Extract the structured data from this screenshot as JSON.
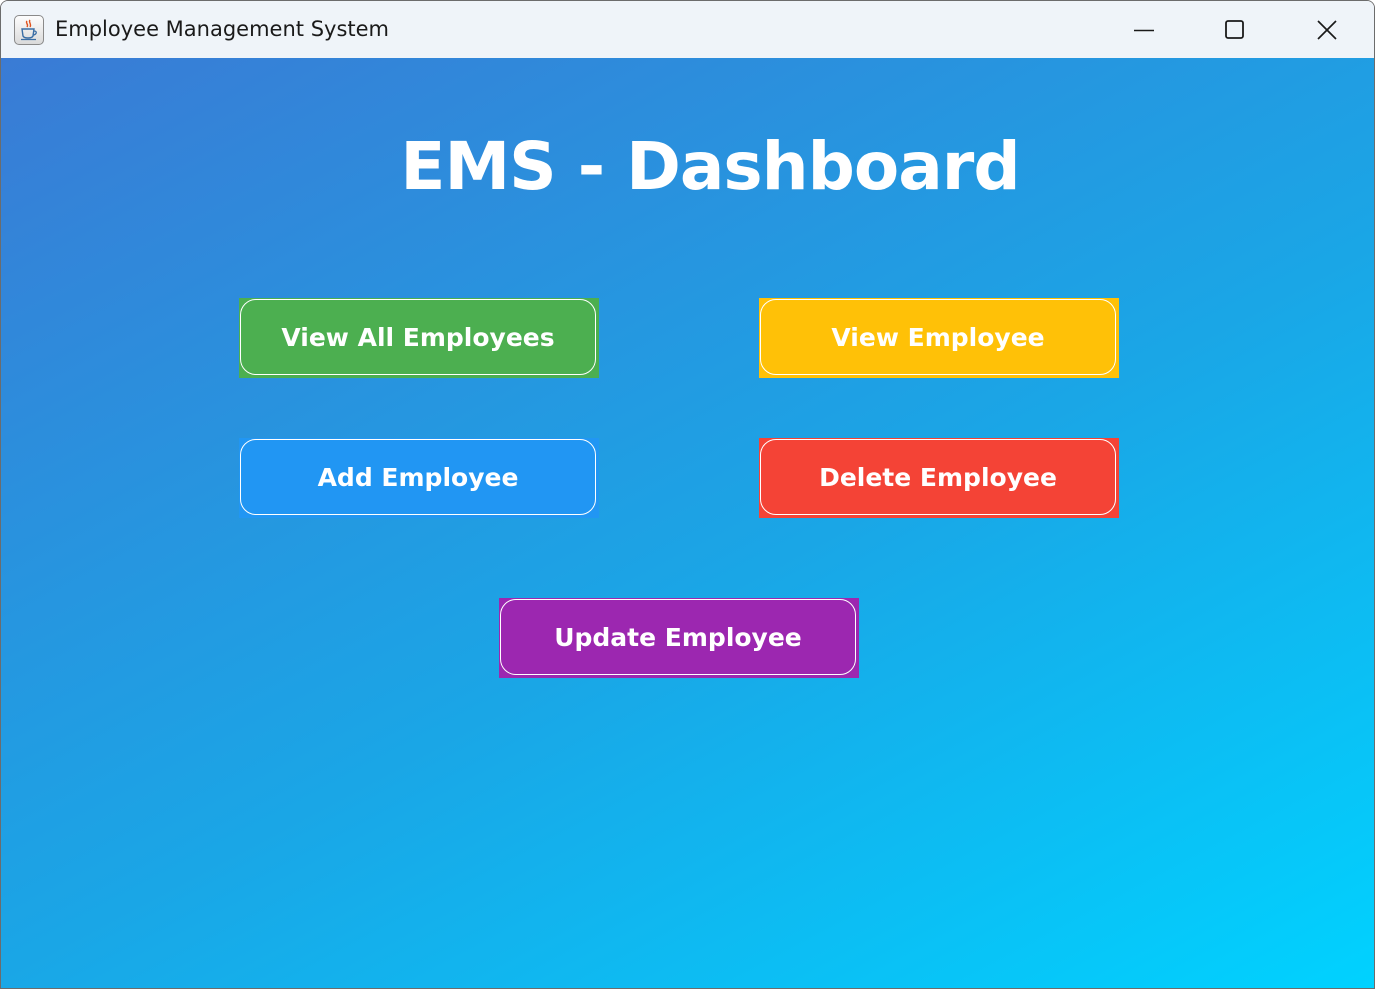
{
  "window": {
    "title": "Employee Management System",
    "icon": "java-cup-icon"
  },
  "controls": {
    "minimize_icon": "minimize-icon",
    "maximize_icon": "maximize-icon",
    "close_icon": "close-icon"
  },
  "dashboard": {
    "heading": "EMS - Dashboard",
    "background_gradient": [
      "#3a7bd5",
      "#00d2ff"
    ],
    "buttons": {
      "view_all": {
        "label": "View All Employees",
        "color": "#4caf50"
      },
      "view": {
        "label": "View Employee",
        "color": "#ffc107"
      },
      "add": {
        "label": "Add Employee",
        "color": "#2196f3"
      },
      "delete": {
        "label": "Delete Employee",
        "color": "#f44336"
      },
      "update": {
        "label": "Update Employee",
        "color": "#9c27b0"
      }
    }
  }
}
